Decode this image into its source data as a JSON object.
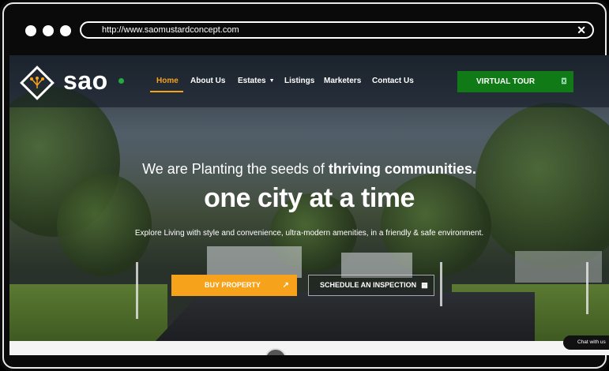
{
  "browser": {
    "url": "http://www.saomustardconcept.com",
    "close_icon": "✕"
  },
  "site": {
    "logo_text": "sao",
    "nav": {
      "home": "Home",
      "about": "About Us",
      "estates": "Estates",
      "listings": "Listings",
      "marketers": "Marketers",
      "contact": "Contact Us",
      "virtual_tour": "VIRTUAL TOUR"
    },
    "hero": {
      "line1_regular": "We are Planting the seeds of ",
      "line1_bold": "thriving communities.",
      "line2": "one city at a time",
      "subtitle": "Explore Living with style and convenience, ultra-modern amenities, in a friendly & safe environment."
    },
    "buttons": {
      "buy": "BUY PROPERTY",
      "schedule": "SCHEDULE AN INSPECTION"
    },
    "chat": "Chat with us"
  },
  "colors": {
    "accent_orange": "#f6a21b",
    "tour_green": "#0f7a16"
  },
  "icons": {
    "arrow": "↗",
    "calendar": "📅",
    "vr": "☐"
  }
}
